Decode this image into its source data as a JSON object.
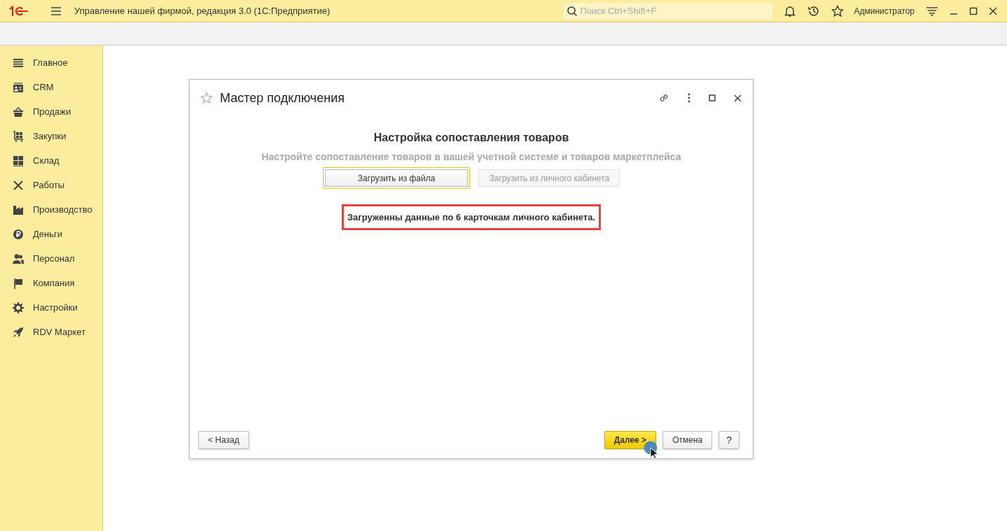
{
  "app_bar": {
    "title": "Управление нашей фирмой, редакция 3.0  (1С:Предприятие)",
    "search": {
      "placeholder": "Поиск Ctrl+Shift+F"
    },
    "user": "Администратор"
  },
  "sidebar": {
    "items": [
      {
        "label": "Главное"
      },
      {
        "label": "CRM"
      },
      {
        "label": "Продажи"
      },
      {
        "label": "Закупки"
      },
      {
        "label": "Склад"
      },
      {
        "label": "Работы"
      },
      {
        "label": "Производство"
      },
      {
        "label": "Деньги"
      },
      {
        "label": "Персонал"
      },
      {
        "label": "Компания"
      },
      {
        "label": "Настройки"
      },
      {
        "label": "RDV Маркет"
      }
    ]
  },
  "dialog": {
    "title": "Мастер подключения",
    "heading": "Настройка сопоставления товаров",
    "subtitle": "Настройте сопоставление товаров в вашей учетной системе и товаров маркетплейса",
    "load_buttons": [
      {
        "label": "Загрузить из файла",
        "focused": true,
        "disabled": false
      },
      {
        "label": "Загрузить из личного кабинета",
        "focused": false,
        "disabled": true
      }
    ],
    "message": {
      "text": "Загруженны данные по 6 карточкам личного кабинета.",
      "highlighted": true
    },
    "footer": {
      "back": "< Назад",
      "next": "Далее >",
      "cancel": "Отмена",
      "help": "?"
    }
  }
}
